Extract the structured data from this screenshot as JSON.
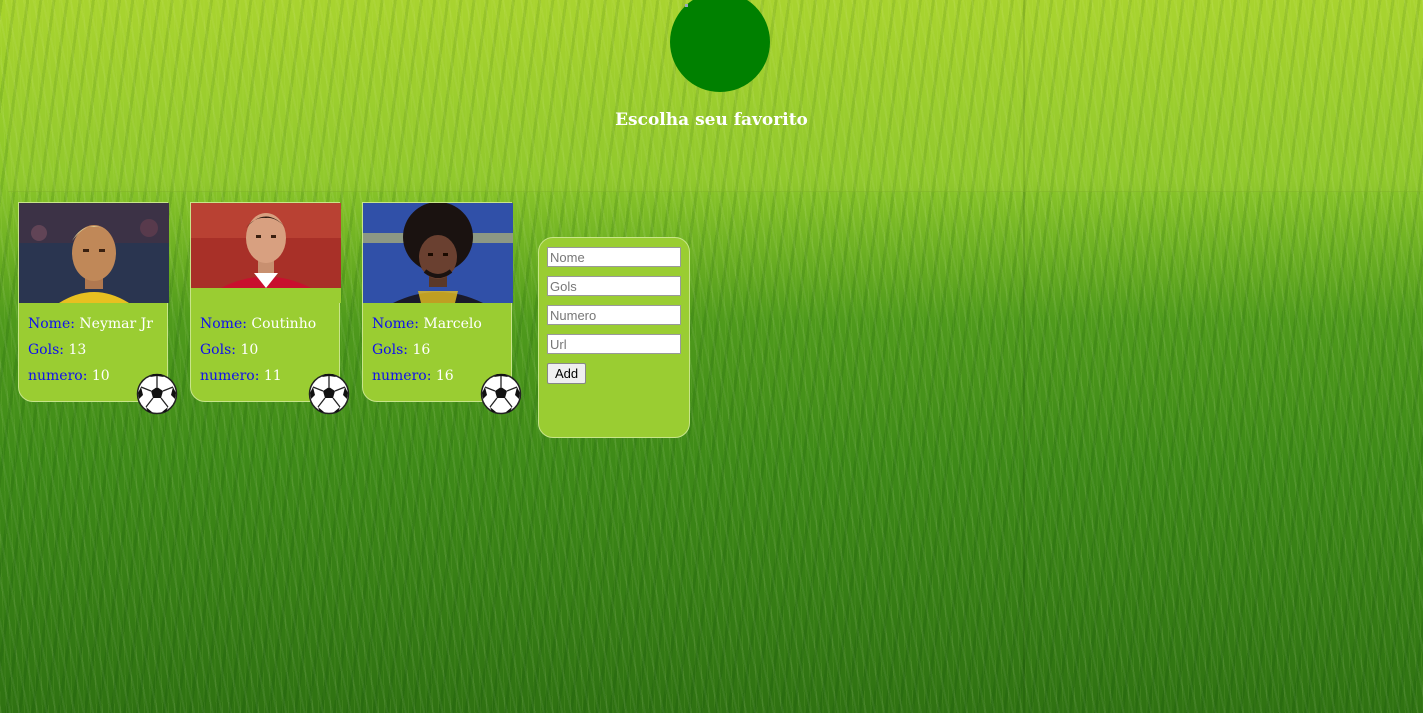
{
  "header": {
    "title": "Escolha seu favorito"
  },
  "players": [
    {
      "nome_label": "Nome:",
      "nome": "Neymar Jr",
      "gols_label": "Gols:",
      "gols": "13",
      "numero_label": "numero:",
      "numero": "10"
    },
    {
      "nome_label": "Nome:",
      "nome": "Coutinho",
      "gols_label": "Gols:",
      "gols": "10",
      "numero_label": "numero:",
      "numero": "11"
    },
    {
      "nome_label": "Nome:",
      "nome": "Marcelo",
      "gols_label": "Gols:",
      "gols": "16",
      "numero_label": "numero:",
      "numero": "16"
    }
  ],
  "form": {
    "nome_placeholder": "Nome",
    "gols_placeholder": "Gols",
    "numero_placeholder": "Numero",
    "url_placeholder": "Url",
    "add_label": "Add"
  },
  "colors": {
    "card": "#9acd32",
    "label": "#1010ee",
    "value": "#ffffff",
    "logo": "#008000"
  },
  "icons": {
    "ball": "soccer-ball-icon"
  }
}
